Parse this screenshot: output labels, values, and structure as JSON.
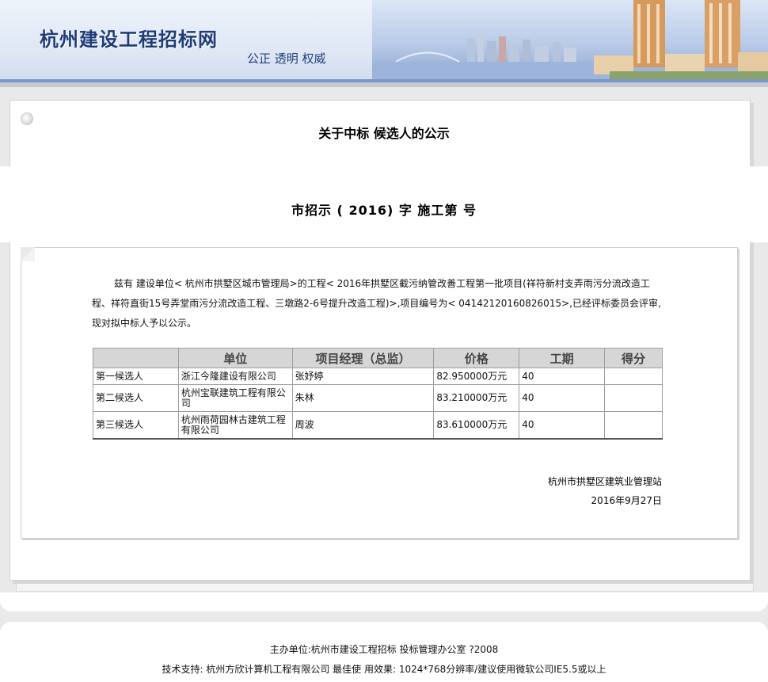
{
  "header": {
    "site_title": "杭州建设工程招标网",
    "slogan": "公正 透明 权威"
  },
  "notice": {
    "title": "关于中标 候选人的公示",
    "doc_number": "市招示 ( 2016) 字 施工第 号",
    "intro": "兹有 建设单位< 杭州市拱墅区城市管理局>的工程< 2016年拱墅区截污纳管改善工程第一批项目(祥符新村支弄雨污分流改造工程、祥符直街15号弄堂雨污分流改造工程、三墩路2-6号提升改造工程)>,项目编号为< 04142120160826015>,已经评标委员会评审, 现对拟中标人予以公示。"
  },
  "table": {
    "headers": [
      "",
      "单位",
      "项目经理（总监）",
      "价格",
      "工期",
      "得分"
    ],
    "rows": [
      {
        "rank": "第一候选人",
        "company": "浙江今隆建设有限公司",
        "manager": "张妤婷",
        "price": "82.950000万元",
        "duration": "40",
        "score": ""
      },
      {
        "rank": "第二候选人",
        "company": "杭州宝联建筑工程有限公司",
        "manager": "朱林",
        "price": "83.210000万元",
        "duration": "40",
        "score": ""
      },
      {
        "rank": "第三候选人",
        "company": "杭州雨荷园林古建筑工程有限公司",
        "manager": "周波",
        "price": "83.610000万元",
        "duration": "40",
        "score": ""
      }
    ]
  },
  "signature": {
    "org": "杭州市拱墅区建筑业管理站",
    "date": "2016年9月27日"
  },
  "footer": {
    "line1": "主办单位:杭州市建设工程招标 投标管理办公室 ?2008",
    "line2": "技术支持: 杭州方欣计算机工程有限公司 最佳使 用效果: 1024*768分辨率/建议使用微软公司IE5.5或以上"
  },
  "colors": {
    "brand_blue": "#1f3c78",
    "table_header_bg": "#d6d6d6"
  }
}
